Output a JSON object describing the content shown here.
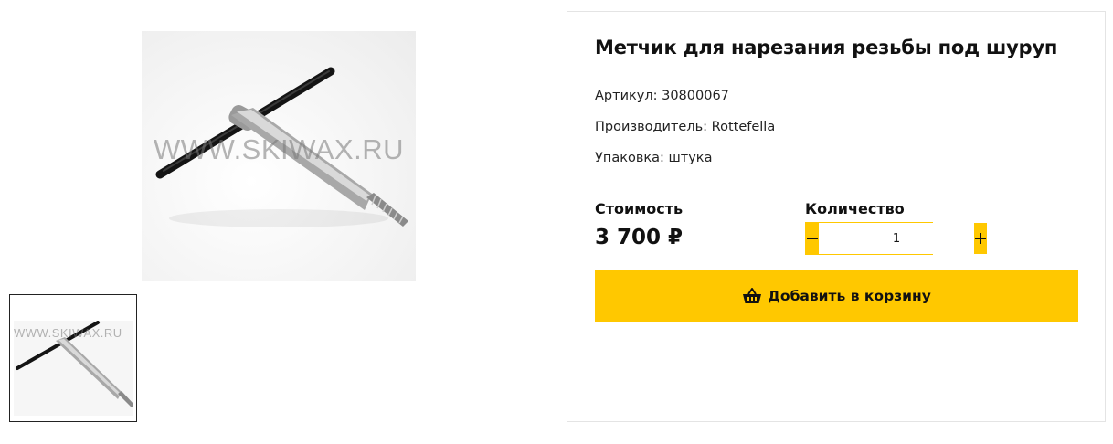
{
  "gallery": {
    "watermark": "WWW.SKIWAX.RU",
    "thumb_watermark": "WWW.SKIWAX.RU"
  },
  "product": {
    "title": "Метчик для нарезания резьбы под шуруп",
    "sku": "Артикул: 30800067",
    "manufacturer": "Производитель: Rottefella",
    "packaging": "Упаковка: штука",
    "price_label": "Стоимость",
    "price": "3 700 ₽",
    "quantity_label": "Количество",
    "quantity_value": "1",
    "add_to_cart_label": "Добавить в корзину"
  },
  "icons": {
    "minus": "minus-icon",
    "plus": "plus-icon",
    "cart": "basket-icon"
  },
  "colors": {
    "accent": "#ffc800",
    "text": "#111111",
    "card_border": "#e4e4e4"
  }
}
